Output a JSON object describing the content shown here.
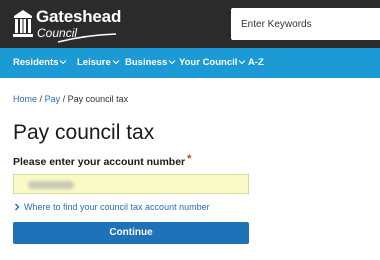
{
  "header": {
    "logo_name": "Gateshead",
    "logo_sub": "Council",
    "search_placeholder": "Enter Keywords"
  },
  "nav": {
    "items": [
      {
        "label": "Residents"
      },
      {
        "label": "Leisure"
      },
      {
        "label": "Business"
      },
      {
        "label": "Your Council"
      },
      {
        "label": "A-Z"
      }
    ]
  },
  "breadcrumb": {
    "items": [
      "Home",
      "Pay",
      "Pay council tax"
    ],
    "separator": "/"
  },
  "main": {
    "title": "Pay council tax",
    "account_label": "Please enter your account number",
    "required_mark": "*",
    "help_link": "Where to find your council tax account number",
    "continue_label": "Continue"
  },
  "colors": {
    "header_bg": "#2b2b2b",
    "nav_bg": "#1c9ad6",
    "button_bg": "#1d72b8",
    "link": "#2a6ebb",
    "input_bg": "#fafac6",
    "required": "#d4351c"
  },
  "icons": {
    "logo": "civic-building-icon",
    "nav_dropdown": "chevron-down-icon",
    "help_link": "chevron-right-icon"
  }
}
